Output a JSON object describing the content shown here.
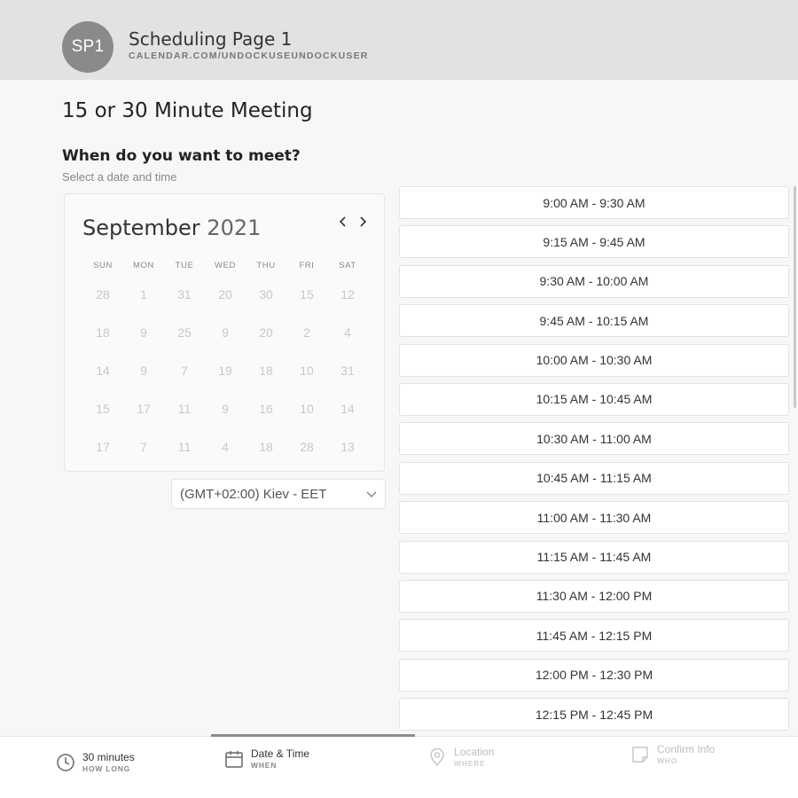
{
  "header": {
    "avatar_initials": "SP1",
    "title": "Scheduling Page 1",
    "url": "CALENDAR.COM/UNDOCKUSEUNDOCKUSER"
  },
  "meeting": {
    "title": "15 or 30 Minute Meeting",
    "question": "When do you want to meet?",
    "subtext": "Select a date and time"
  },
  "calendar": {
    "month": "September",
    "year": "2021",
    "prev_label": "‹",
    "next_label": "›",
    "weekdays": [
      "SUN",
      "MON",
      "TUE",
      "WED",
      "THU",
      "FRI",
      "SAT"
    ],
    "weeks": [
      [
        "28",
        "1",
        "31",
        "20",
        "30",
        "15",
        "12"
      ],
      [
        "18",
        "9",
        "25",
        "9",
        "20",
        "2",
        "4"
      ],
      [
        "14",
        "9",
        "7",
        "19",
        "18",
        "10",
        "31"
      ],
      [
        "15",
        "17",
        "11",
        "9",
        "16",
        "10",
        "14"
      ],
      [
        "17",
        "7",
        "11",
        "4",
        "18",
        "28",
        "13"
      ]
    ]
  },
  "timezone": {
    "value": "(GMT+02:00) Kiev - EET"
  },
  "time_slots": [
    "9:00 AM - 9:30 AM",
    "9:15 AM - 9:45 AM",
    "9:30 AM - 10:00 AM",
    "9:45 AM - 10:15 AM",
    "10:00 AM - 10:30 AM",
    "10:15 AM - 10:45 AM",
    "10:30 AM - 11:00 AM",
    "10:45 AM - 11:15 AM",
    "11:00 AM - 11:30 AM",
    "11:15 AM - 11:45 AM",
    "11:30 AM - 12:00 PM",
    "11:45 AM - 12:15 PM",
    "12:00 PM - 12:30 PM",
    "12:15 PM - 12:45 PM"
  ],
  "steps": [
    {
      "label": "30 minutes",
      "sub": "HOW LONG",
      "icon": "clock-icon",
      "state": "done"
    },
    {
      "label": "Date & Time",
      "sub": "WHEN",
      "icon": "calendar-icon",
      "state": "active"
    },
    {
      "label": "Location",
      "sub": "WHERE",
      "icon": "location-pin-icon",
      "state": "pending"
    },
    {
      "label": "Confirm Info",
      "sub": "WHO",
      "icon": "note-icon",
      "state": "pending"
    }
  ],
  "colors": {
    "header_bg": "#e2e2e2",
    "avatar_bg": "#8a8a8a",
    "page_bg": "#f7f7f7",
    "slot_bg": "#ffffff",
    "progress": "#8c8c8c"
  }
}
